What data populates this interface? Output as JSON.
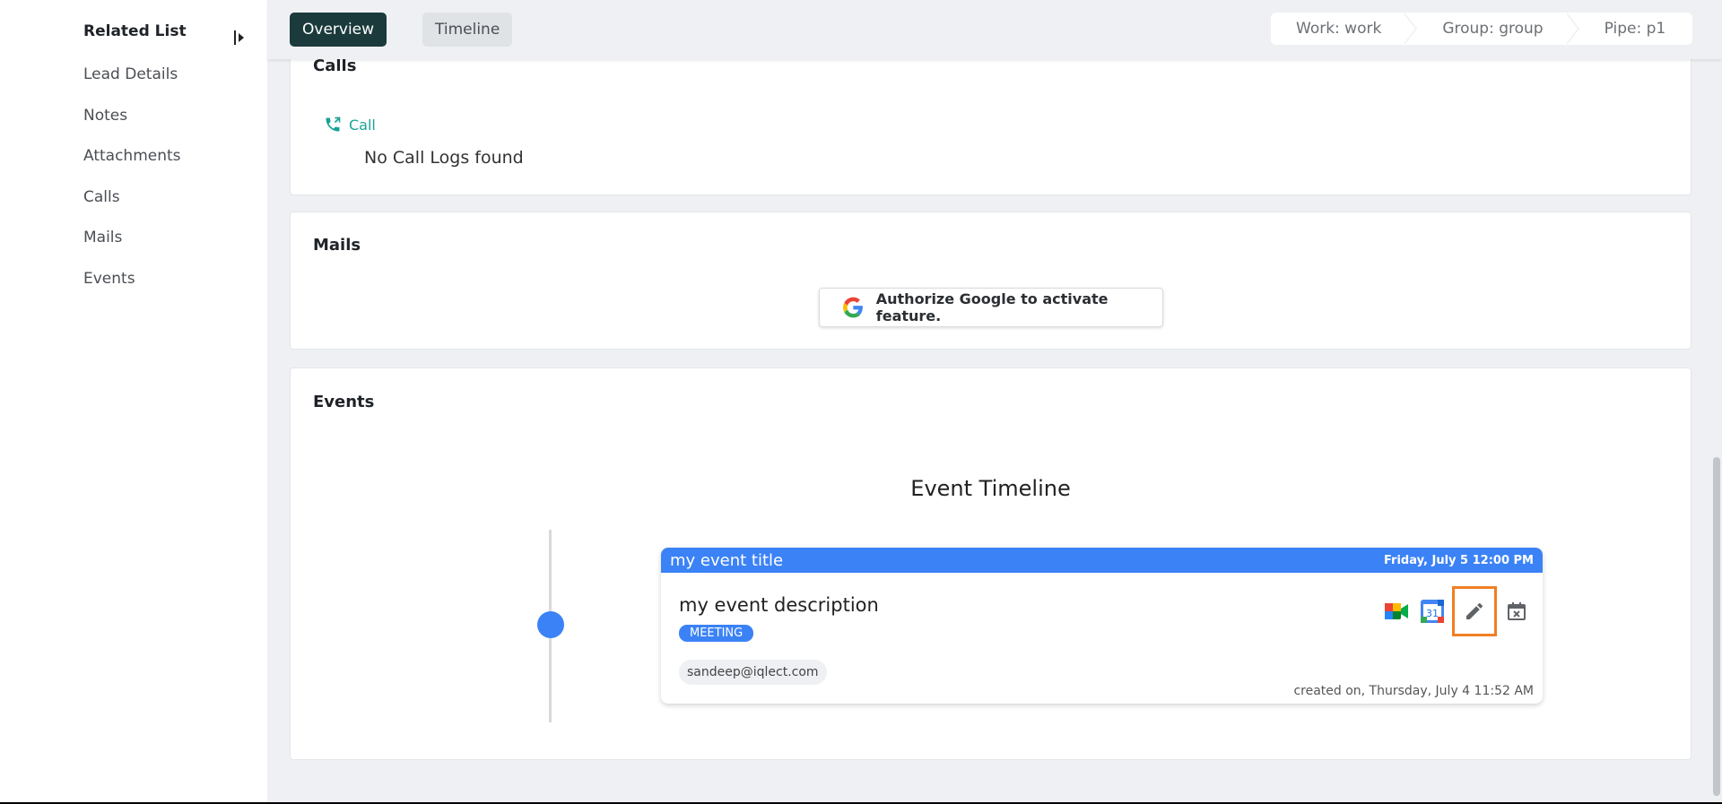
{
  "sidebar": {
    "title": "Related List",
    "items": [
      {
        "label": "Lead Details"
      },
      {
        "label": "Notes"
      },
      {
        "label": "Attachments"
      },
      {
        "label": "Calls"
      },
      {
        "label": "Mails"
      },
      {
        "label": "Events"
      }
    ]
  },
  "tabs": [
    {
      "label": "Overview",
      "active": true
    },
    {
      "label": "Timeline",
      "active": false
    }
  ],
  "breadcrumbs": [
    {
      "label": "Work: work"
    },
    {
      "label": "Group: group"
    },
    {
      "label": "Pipe: p1"
    }
  ],
  "calls": {
    "title": "Calls",
    "call_link": "Call",
    "empty_text": "No Call Logs found"
  },
  "mails": {
    "title": "Mails",
    "authorize_label": "Authorize Google to activate feature."
  },
  "events": {
    "title": "Events",
    "timeline_heading": "Event Timeline",
    "items": [
      {
        "title": "my event title",
        "date": "Friday, July 5 12:00 PM",
        "description": "my event description",
        "type_badge": "MEETING",
        "attendee": "sandeep@iqlect.com",
        "created": "created on, Thursday, July 4 11:52 AM",
        "calendar_day": "31"
      }
    ]
  },
  "colors": {
    "accent": "#3b82f6",
    "active_tab": "#1b3a3c",
    "call_green": "#1aa394",
    "highlight": "#f07f24"
  },
  "icons": [
    "collapse-sidebar-icon",
    "phone-call-icon",
    "google-logo-icon",
    "google-meet-icon",
    "google-calendar-icon",
    "edit-pencil-icon",
    "calendar-cancel-icon"
  ]
}
